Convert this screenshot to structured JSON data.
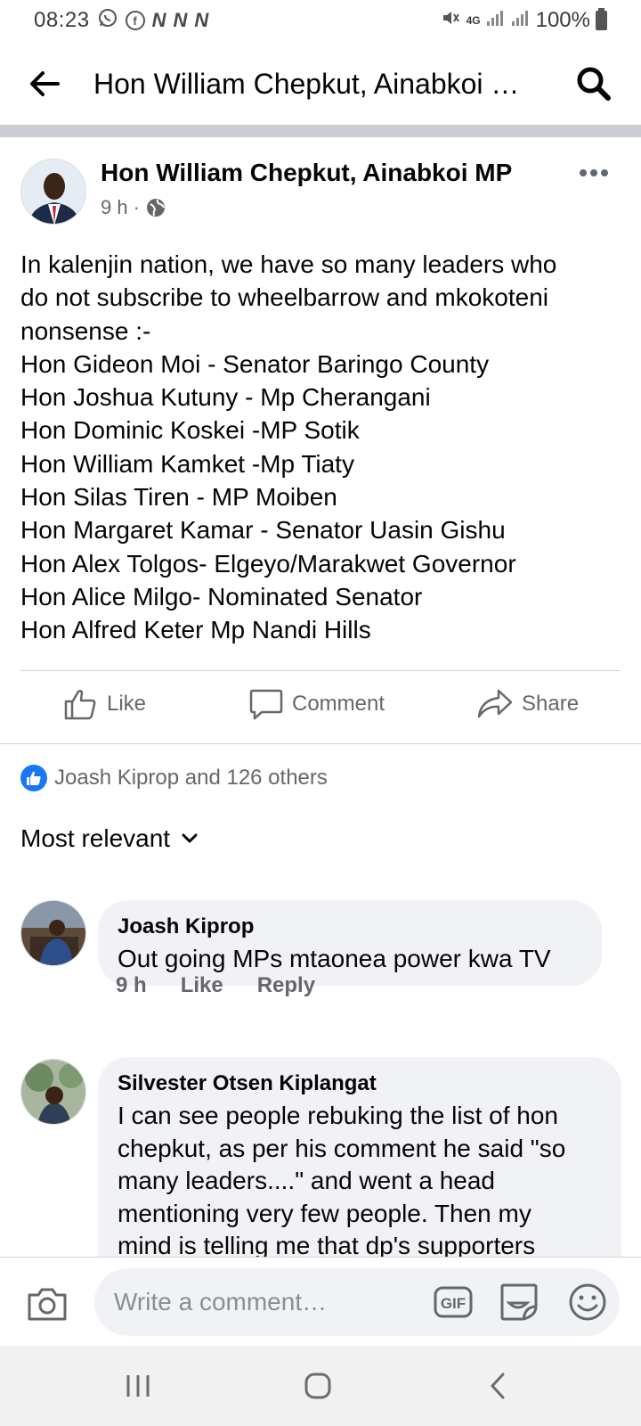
{
  "status_bar": {
    "time": "08:23",
    "notification_letters": [
      "N",
      "N",
      "N"
    ],
    "network": "4G",
    "battery": "100%"
  },
  "header": {
    "title": "Hon William Chepkut, Ainabkoi MP"
  },
  "post": {
    "author": "Hon William Chepkut, Ainabkoi MP",
    "time": "9 h",
    "visibility_separator": "·",
    "lines": [
      "In kalenjin nation, we have so many leaders who",
      "do not subscribe to wheelbarrow and mkokoteni",
      "nonsense :-",
      "Hon Gideon Moi - Senator Baringo County",
      "Hon Joshua Kutuny - Mp Cherangani",
      "Hon Dominic Koskei -MP Sotik",
      "Hon William Kamket -Mp Tiaty",
      "Hon Silas Tiren - MP Moiben",
      "Hon Margaret Kamar - Senator Uasin Gishu",
      "Hon Alex Tolgos- Elgeyo/Marakwet Governor",
      "Hon Alice Milgo- Nominated Senator",
      "Hon Alfred Keter Mp Nandi Hills"
    ]
  },
  "actions": {
    "like": "Like",
    "comment": "Comment",
    "share": "Share"
  },
  "reactions": {
    "summary": "Joash Kiprop and 126 others"
  },
  "sort": {
    "label": "Most relevant"
  },
  "comments": [
    {
      "name": "Joash Kiprop",
      "lines": [
        "Out going MPs mtaonea power kwa TV"
      ],
      "time": "9 h",
      "like": "Like",
      "reply": "Reply"
    },
    {
      "name": "Silvester Otsen Kiplangat",
      "lines": [
        "I can see people rebuking the list of hon",
        "chepkut, as per his comment he said \"so",
        "many leaders....\" and went a head",
        "mentioning very few people. Then my",
        "mind is telling me that dp's supporters"
      ]
    }
  ],
  "composer": {
    "placeholder": "Write a comment…",
    "gif_label": "GIF"
  },
  "colors": {
    "accent": "#1877f2",
    "secondary_text": "#65676b",
    "bubble": "#f0f2f5",
    "divider": "#c9ccd1"
  }
}
